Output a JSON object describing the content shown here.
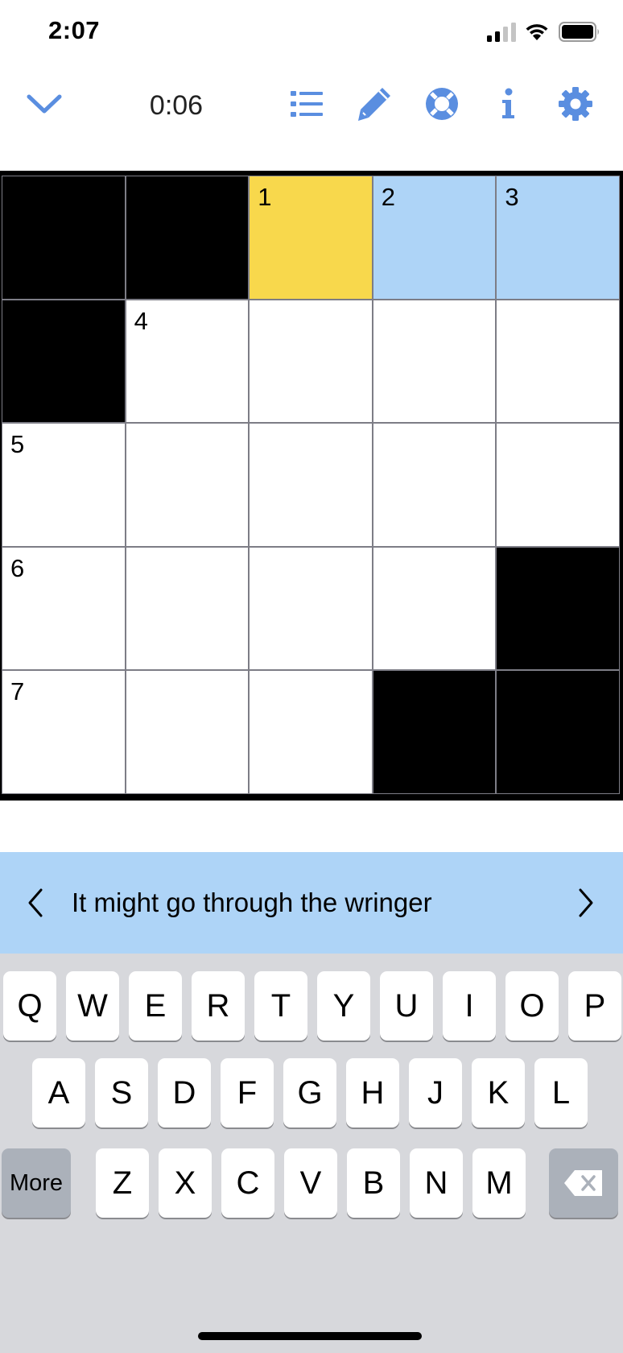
{
  "status": {
    "time": "2:07"
  },
  "toolbar": {
    "timer": "0:06"
  },
  "colors": {
    "accent": "#5a8ee0",
    "selected_cell": "#f8d84c",
    "word_highlight": "#aed4f7"
  },
  "grid": {
    "size": 5,
    "cells": [
      [
        {
          "black": true
        },
        {
          "black": true
        },
        {
          "num": "1",
          "state": "selected"
        },
        {
          "num": "2",
          "state": "word"
        },
        {
          "num": "3",
          "state": "word"
        }
      ],
      [
        {
          "black": true
        },
        {
          "num": "4"
        },
        {},
        {},
        {}
      ],
      [
        {
          "num": "5"
        },
        {},
        {},
        {},
        {}
      ],
      [
        {
          "num": "6"
        },
        {},
        {},
        {},
        {
          "black": true
        }
      ],
      [
        {
          "num": "7"
        },
        {},
        {},
        {
          "black": true
        },
        {
          "black": true
        }
      ]
    ]
  },
  "clue": {
    "text": "It might go through the wringer"
  },
  "keyboard": {
    "row1": [
      "Q",
      "W",
      "E",
      "R",
      "T",
      "Y",
      "U",
      "I",
      "O",
      "P"
    ],
    "row2": [
      "A",
      "S",
      "D",
      "F",
      "G",
      "H",
      "J",
      "K",
      "L"
    ],
    "row3": [
      "Z",
      "X",
      "C",
      "V",
      "B",
      "N",
      "M"
    ],
    "more_label": "More"
  }
}
